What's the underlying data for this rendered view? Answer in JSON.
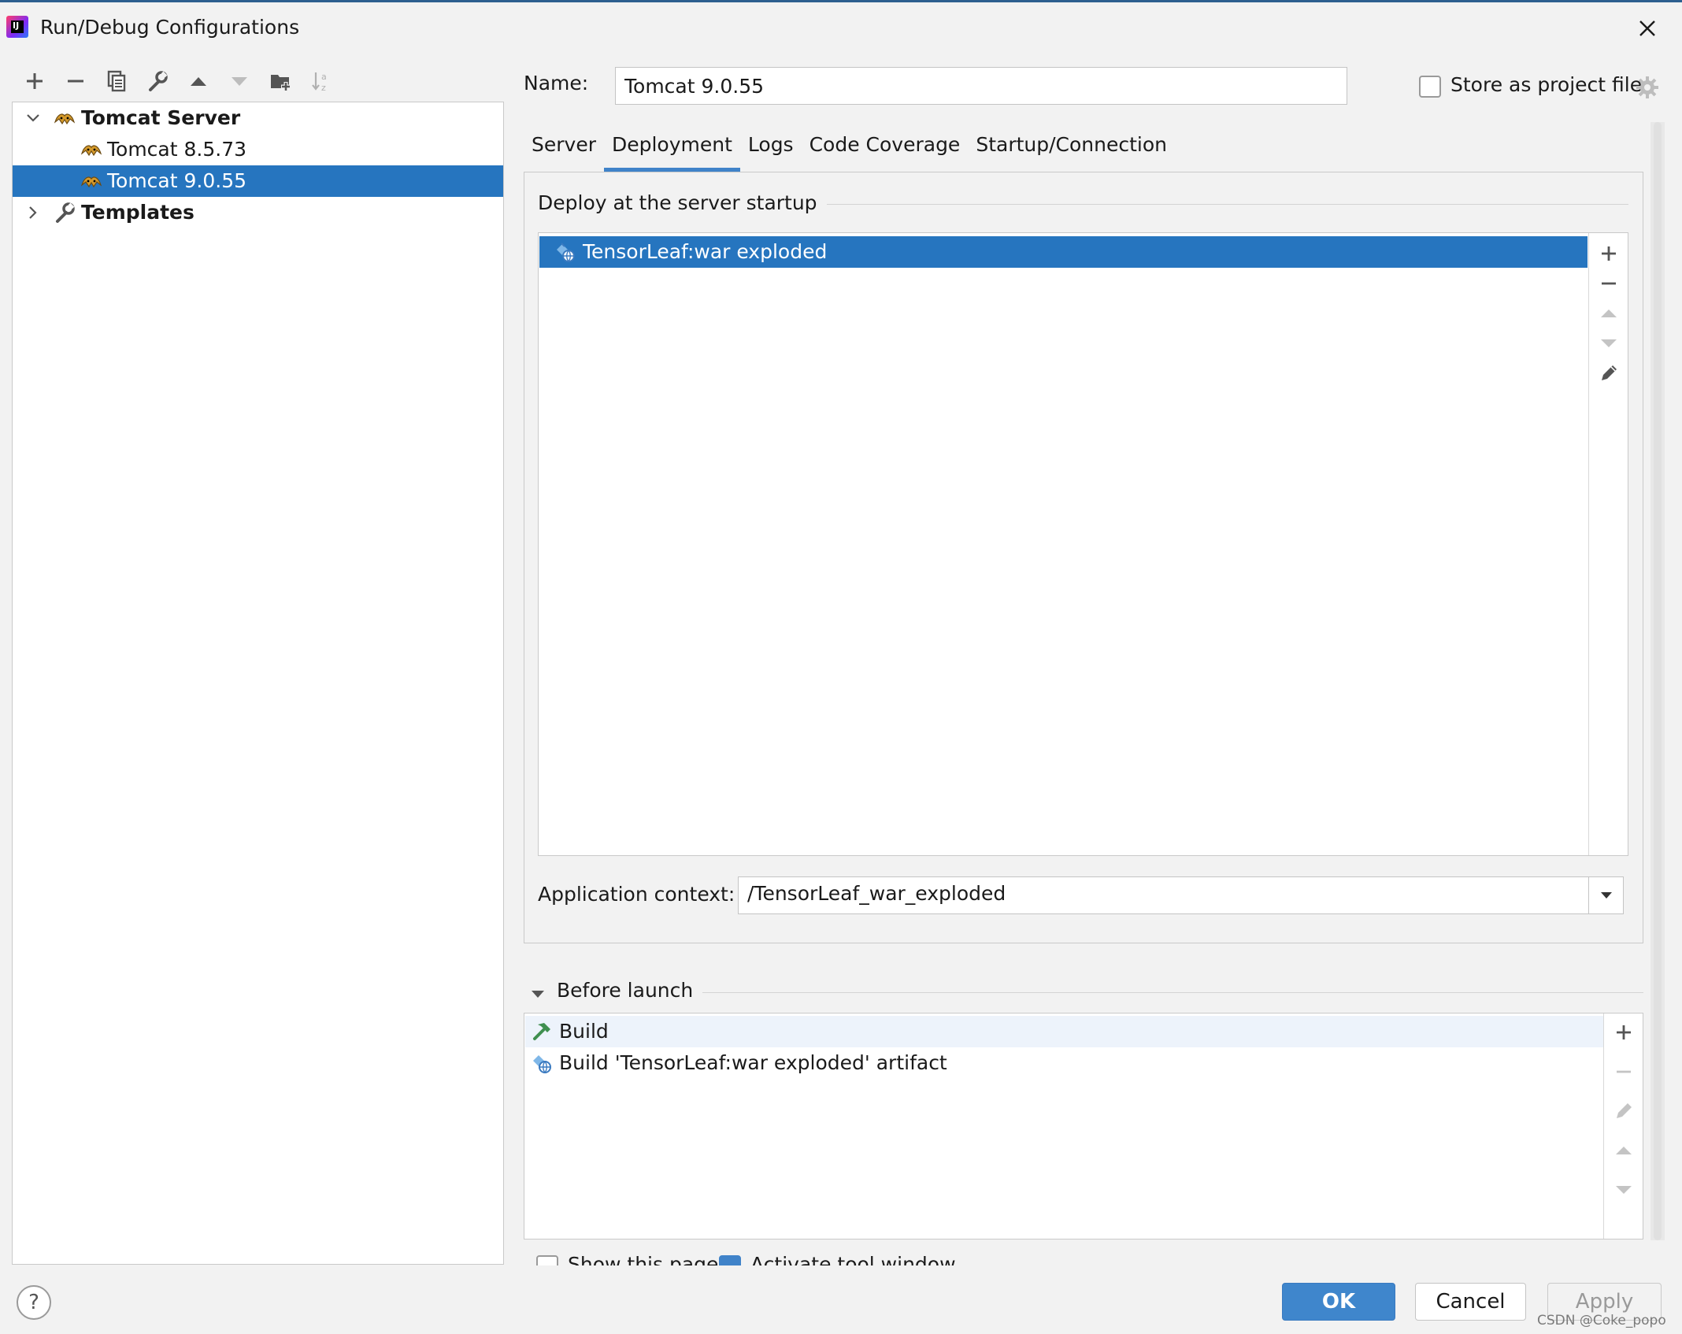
{
  "window": {
    "title": "Run/Debug Configurations"
  },
  "toolbar": {
    "icons": [
      "add-icon",
      "remove-icon",
      "copy-icon",
      "wrench-icon",
      "move-up-icon",
      "move-down-icon",
      "new-folder-icon",
      "sort-icon"
    ]
  },
  "tree": {
    "group_label": "Tomcat Server",
    "items": [
      {
        "label": "Tomcat 8.5.73",
        "selected": false
      },
      {
        "label": "Tomcat 9.0.55",
        "selected": true
      }
    ],
    "templates_label": "Templates"
  },
  "config": {
    "name_label": "Name:",
    "name_value": "Tomcat 9.0.55",
    "store_label": "Store as project file",
    "store_checked": false
  },
  "tabs": [
    {
      "label": "Server",
      "active": false
    },
    {
      "label": "Deployment",
      "active": true
    },
    {
      "label": "Logs",
      "active": false
    },
    {
      "label": "Code Coverage",
      "active": false
    },
    {
      "label": "Startup/Connection",
      "active": false
    }
  ],
  "deployment": {
    "section_title": "Deploy at the server startup",
    "artifact": "TensorLeaf:war exploded",
    "context_label": "Application context:",
    "context_value": "/TensorLeaf_war_exploded"
  },
  "before_launch": {
    "title": "Before launch",
    "items": [
      "Build",
      "Build 'TensorLeaf:war exploded' artifact"
    ]
  },
  "options": {
    "show_page_label": "Show this page",
    "show_page_checked": false,
    "activate_label": "Activate tool window",
    "activate_checked": true
  },
  "buttons": {
    "help": "?",
    "ok": "OK",
    "cancel": "Cancel",
    "apply": "Apply"
  },
  "watermark": "CSDN @Coke_popo",
  "colors": {
    "selection": "#2675bf",
    "accent": "#4083c9",
    "background": "#f2f2f2"
  }
}
